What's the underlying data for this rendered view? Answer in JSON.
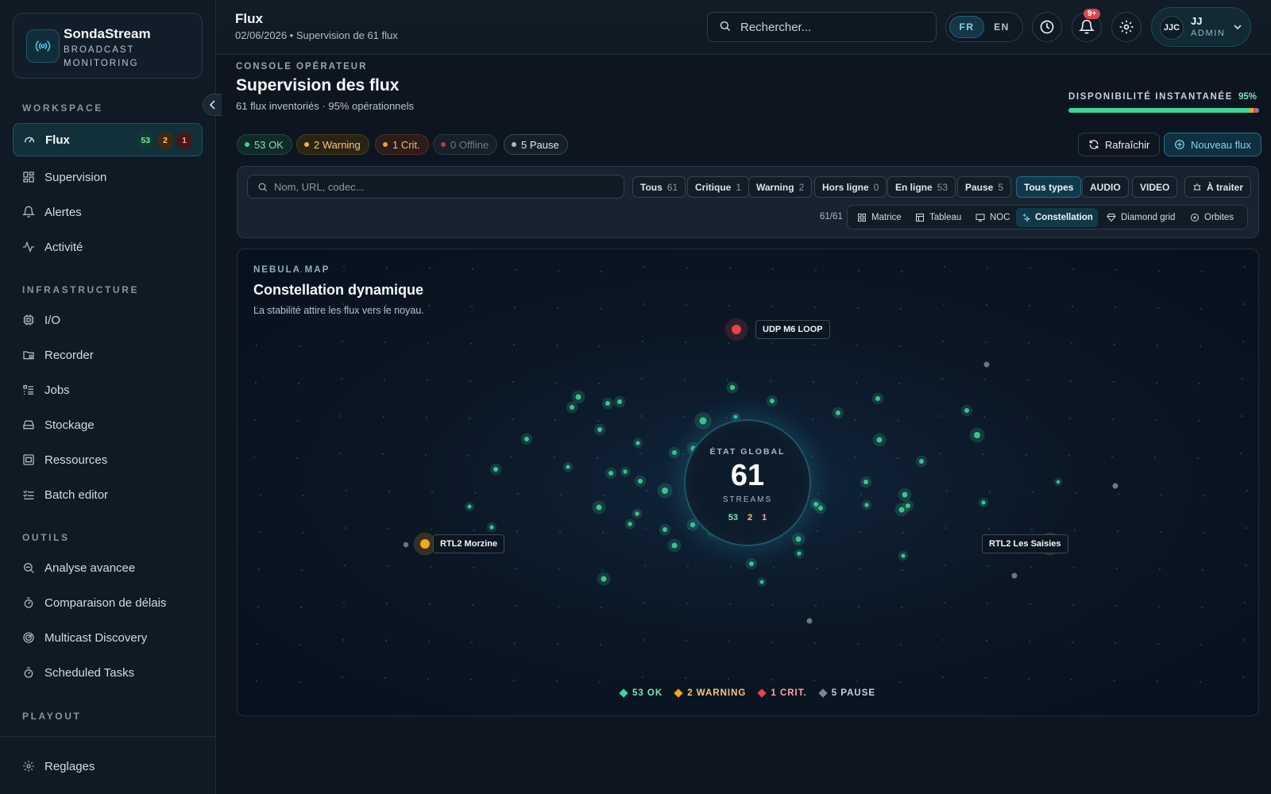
{
  "brand": {
    "name": "SondaStream",
    "subtitle": "BROADCAST MONITORING"
  },
  "sidebar": {
    "sections": {
      "workspace": "WORKSPACE",
      "infrastructure": "INFRASTRUCTURE",
      "tools": "OUTILS",
      "playout": "PLAYOUT"
    },
    "workspace_items": [
      {
        "label": "Flux",
        "icon": "gauge-icon",
        "badges": {
          "ok": "53",
          "warn": "2",
          "crit": "1"
        }
      },
      {
        "label": "Supervision",
        "icon": "grid-icon"
      },
      {
        "label": "Alertes",
        "icon": "bell-icon"
      },
      {
        "label": "Activité",
        "icon": "activity-icon"
      }
    ],
    "infrastructure_items": [
      {
        "label": "I/O",
        "icon": "chip-icon"
      },
      {
        "label": "Recorder",
        "icon": "folder-record-icon"
      },
      {
        "label": "Jobs",
        "icon": "list-icon"
      },
      {
        "label": "Stockage",
        "icon": "drive-icon"
      },
      {
        "label": "Ressources",
        "icon": "server-icon"
      },
      {
        "label": "Batch editor",
        "icon": "checklist-icon"
      }
    ],
    "tools_items": [
      {
        "label": "Analyse avancee",
        "icon": "search-analysis-icon"
      },
      {
        "label": "Comparaison de délais",
        "icon": "timer-icon"
      },
      {
        "label": "Multicast Discovery",
        "icon": "radar-icon"
      },
      {
        "label": "Scheduled Tasks",
        "icon": "timer-icon"
      }
    ],
    "footer": {
      "label": "Reglages",
      "icon": "gear-icon"
    }
  },
  "topbar": {
    "title": "Flux",
    "subtitle": "02/06/2026 • Supervision de 61 flux",
    "search_placeholder": "Rechercher...",
    "lang_fr": "FR",
    "lang_en": "EN",
    "notif_badge": "9+",
    "user": {
      "initials": "JJC",
      "name": "JJ",
      "role": "ADMIN"
    }
  },
  "header": {
    "kicker": "CONSOLE OPÉRATEUR",
    "title": "Supervision des flux",
    "subtitle": "61 flux inventoriés · 95% opérationnels",
    "availability_label": "DISPONIBILITÉ INSTANTANÉE",
    "availability_value": "95%",
    "availability_fraction": {
      "ok": 0.95,
      "warn": 0.02,
      "crit": 0.01,
      "pause": 0.02
    }
  },
  "status_chips": [
    {
      "label": "53 OK",
      "color": "#3fd39a"
    },
    {
      "label": "2 Warning",
      "color": "#f2b23a"
    },
    {
      "label": "1 Crit.",
      "color": "#f39a3c"
    },
    {
      "label": "0 Offline",
      "color": "#b04049"
    },
    {
      "label": "5 Pause",
      "color": "#aeb8c3"
    }
  ],
  "actions": {
    "refresh": "Rafraîchir",
    "new_flux": "Nouveau flux"
  },
  "filters": {
    "search_placeholder": "Nom, URL, codec...",
    "state_buttons": [
      {
        "label": "Tous",
        "count": "61"
      },
      {
        "label": "Critique",
        "count": "1"
      },
      {
        "label": "Warning",
        "count": "2"
      },
      {
        "label": "Hors ligne",
        "count": "0"
      },
      {
        "label": "En ligne",
        "count": "53"
      },
      {
        "label": "Pause",
        "count": "5"
      }
    ],
    "type_buttons": [
      "Tous types",
      "AUDIO",
      "VIDEO"
    ],
    "todo_button": "À traiter",
    "result_count": "61/61",
    "views": [
      "Matrice",
      "Tableau",
      "NOC",
      "Constellation",
      "Diamond grid",
      "Orbites"
    ],
    "active_view": "Constellation"
  },
  "map": {
    "kicker": "NEBULA MAP",
    "title": "Constellation dynamique",
    "subtitle": "La stabilité attire les flux vers le noyau.",
    "core": {
      "kicker": "ÉTAT GLOBAL",
      "value": "61",
      "unit": "STREAMS",
      "ok": "53",
      "warn": "2",
      "crit": "1"
    },
    "tags": {
      "crit": "UDP M6 LOOP",
      "warn_left": "RTL2 Morzine",
      "warn_right": "RTL2 Les Saisies"
    },
    "legend": {
      "ok": "53 OK",
      "warn": "2 WARNING",
      "crit": "1 CRIT.",
      "pause": "5 PAUSE"
    },
    "colors": {
      "ok": "#3fd39a",
      "warn": "#f2a51e",
      "crit": "#e2454d",
      "pause": "#7b8795",
      "accent": "#7fd4ea"
    }
  }
}
